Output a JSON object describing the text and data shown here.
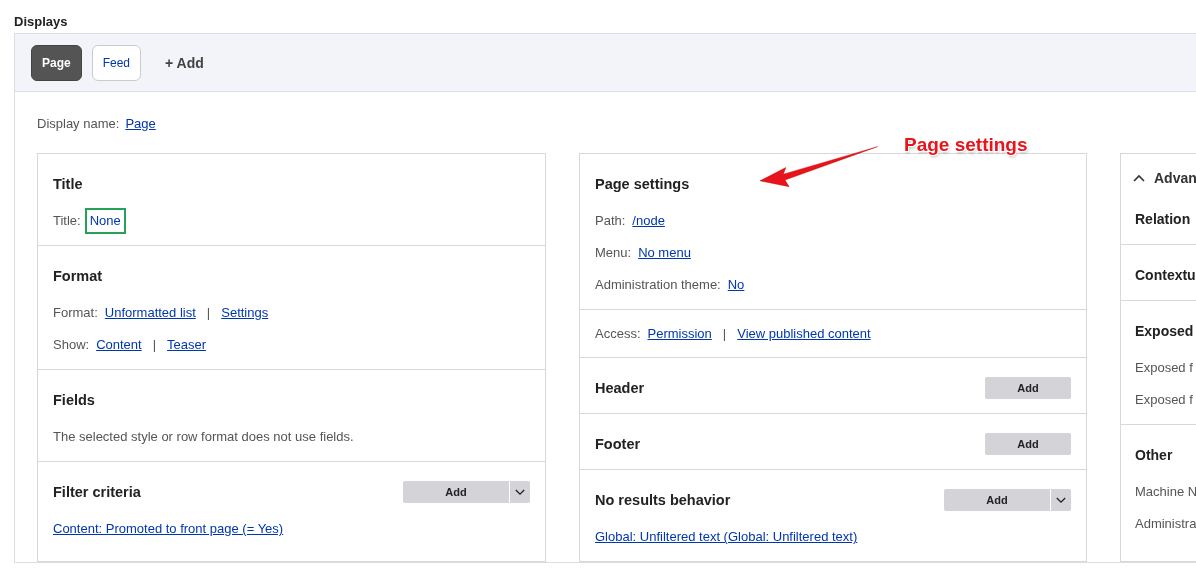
{
  "heading": "Displays",
  "tabs": [
    {
      "label": "Page",
      "selected": true
    },
    {
      "label": "Feed",
      "selected": false
    }
  ],
  "add_display": "+ Add",
  "display_name": {
    "label": "Display name:",
    "value": "Page"
  },
  "columns": [
    {
      "sections": [
        {
          "kind": "section",
          "title": "Title",
          "rows": [
            {
              "label": "Title:",
              "links": [
                {
                  "text": "None",
                  "highlighted": true
                }
              ]
            }
          ]
        },
        {
          "kind": "section",
          "title": "Format",
          "rows": [
            {
              "label": "Format:",
              "separator": "|",
              "links": [
                {
                  "text": "Unformatted list",
                  "highlighted": false
                },
                {
                  "text": "Settings",
                  "highlighted": false
                }
              ]
            },
            {
              "label": "Show:",
              "separator": "|",
              "links": [
                {
                  "text": "Content",
                  "highlighted": false
                },
                {
                  "text": "Teaser",
                  "highlighted": false
                }
              ]
            }
          ]
        },
        {
          "kind": "section",
          "title": "Fields",
          "text": "The selected style or row format does not use fields."
        },
        {
          "kind": "section",
          "title": "Filter criteria",
          "add_button": {
            "label": "Add",
            "dropdown": true
          },
          "rows": [
            {
              "links": [
                {
                  "text": "Content: Promoted to front page (= Yes)",
                  "highlighted": false
                }
              ]
            }
          ]
        }
      ]
    },
    {
      "sections": [
        {
          "kind": "section",
          "title": "Page settings",
          "rows": [
            {
              "label": "Path:",
              "links": [
                {
                  "text": "/node",
                  "highlighted": false
                }
              ]
            },
            {
              "label": "Menu:",
              "links": [
                {
                  "text": "No menu",
                  "highlighted": false
                }
              ]
            },
            {
              "label": "Administration theme:",
              "links": [
                {
                  "text": "No",
                  "highlighted": false
                }
              ]
            }
          ]
        },
        {
          "kind": "section",
          "rows": [
            {
              "label": "Access:",
              "separator": "|",
              "links": [
                {
                  "text": "Permission",
                  "highlighted": false
                },
                {
                  "text": "View published content",
                  "highlighted": false
                }
              ]
            }
          ]
        },
        {
          "kind": "section",
          "title": "Header",
          "add_button": {
            "label": "Add",
            "dropdown": false
          }
        },
        {
          "kind": "section",
          "title": "Footer",
          "add_button": {
            "label": "Add",
            "dropdown": false
          }
        },
        {
          "kind": "section",
          "title": "No results behavior",
          "add_button": {
            "label": "Add",
            "dropdown": true
          },
          "rows": [
            {
              "links": [
                {
                  "text": "Global: Unfiltered text (Global: Unfiltered text)",
                  "highlighted": false
                }
              ]
            }
          ]
        }
      ]
    },
    {
      "sections": [
        {
          "kind": "toggle",
          "title": "Advan",
          "expanded": true
        },
        {
          "kind": "section",
          "title": "Relation"
        },
        {
          "kind": "section",
          "title": "Contextu"
        },
        {
          "kind": "section",
          "title": "Exposed",
          "rows": [
            {
              "label": "Exposed f"
            },
            {
              "label": "Exposed f"
            }
          ]
        },
        {
          "kind": "section",
          "title": "Other",
          "rows": [
            {
              "label": "Machine N"
            },
            {
              "label": "Administra"
            }
          ]
        }
      ]
    }
  ],
  "annotation": "Page settings"
}
